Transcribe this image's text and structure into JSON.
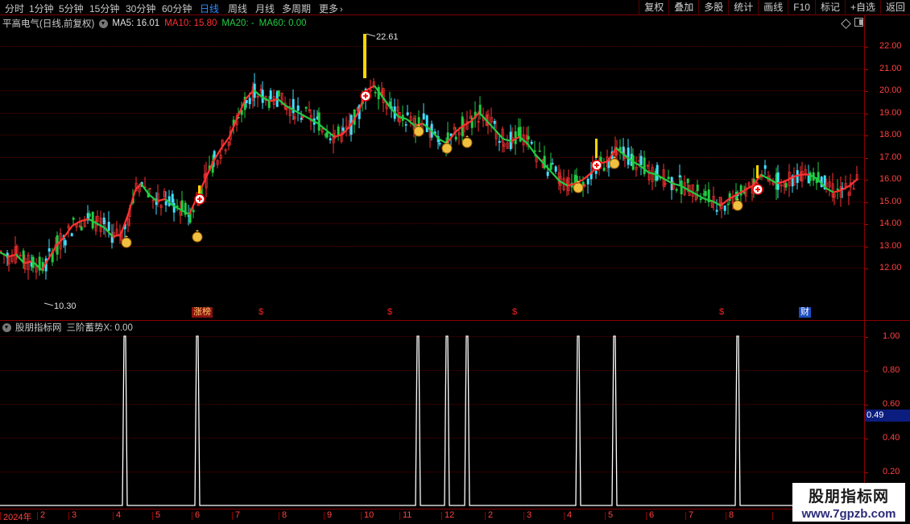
{
  "toolbar": {
    "periods": [
      {
        "label": "分时",
        "active": false
      },
      {
        "label": "1分钟",
        "active": false
      },
      {
        "label": "5分钟",
        "active": false
      },
      {
        "label": "15分钟",
        "active": false
      },
      {
        "label": "30分钟",
        "active": false
      },
      {
        "label": "60分钟",
        "active": false
      },
      {
        "label": "日线",
        "active": true
      },
      {
        "label": "周线",
        "active": false
      },
      {
        "label": "月线",
        "active": false
      },
      {
        "label": "多周期",
        "active": false
      },
      {
        "label": "更多",
        "active": false
      }
    ],
    "more_icon": "chevron-right-icon",
    "actions": [
      "复权",
      "叠加",
      "多股",
      "统计",
      "画线",
      "F10",
      "标记",
      "+自选",
      "返回"
    ]
  },
  "main_chart": {
    "title": "平高电气(日线,前复权)",
    "ma5": "MA5: 16.01",
    "ma10": "MA10: 15.80",
    "ma20": "MA20: -",
    "ma60": "MA60: 0.00",
    "high_label": "22.61",
    "low_label": "10.30"
  },
  "indicator": {
    "title": "股朋指标网",
    "formula": "三阶蓄势X: 0.00",
    "current_value": "0.49"
  },
  "event_markers": [
    {
      "label": "涨榜",
      "kind": "zt"
    },
    {
      "label": "$",
      "kind": "div"
    },
    {
      "label": "$",
      "kind": "div"
    },
    {
      "label": "$",
      "kind": "div"
    },
    {
      "label": "$",
      "kind": "div"
    },
    {
      "label": "财",
      "kind": "cai"
    }
  ],
  "watermark": {
    "name": "股朋指标网",
    "url": "www.7gpzb.com"
  },
  "colors": {
    "background": "#000000",
    "up": "#ff3232",
    "down": "#22cc44",
    "axis_text": "#ff4040",
    "grid": "#5a0000",
    "cyan_candle": "#40e0ff",
    "signal_line": "#ffffff"
  },
  "chart_data": [
    {
      "type": "candlestick",
      "title": "平高电气(日线,前复权)",
      "x_range": [
        "2024-01",
        "2024-08"
      ],
      "date_ticks": [
        "2024年",
        "2",
        "3",
        "4",
        "5",
        "6",
        "7",
        "8",
        "9",
        "10",
        "11",
        "12",
        "2",
        "3",
        "4",
        "5",
        "6",
        "7",
        "8"
      ],
      "price_ticks": [
        "22.00",
        "21.00",
        "20.00",
        "19.00",
        "18.00",
        "17.00",
        "16.00",
        "15.00",
        "14.00",
        "13.00",
        "12.00"
      ],
      "ylim": [
        10.3,
        22.61
      ],
      "price_points": [
        [
          0,
          12.7
        ],
        [
          10,
          12.5
        ],
        [
          20,
          12.6
        ],
        [
          30,
          12.2
        ],
        [
          40,
          12.3
        ],
        [
          52,
          11.9
        ],
        [
          60,
          12.4
        ],
        [
          70,
          13.0
        ],
        [
          80,
          13.4
        ],
        [
          90,
          13.9
        ],
        [
          100,
          14.1
        ],
        [
          110,
          14.2
        ],
        [
          120,
          14.0
        ],
        [
          130,
          13.8
        ],
        [
          140,
          13.4
        ],
        [
          150,
          13.5
        ],
        [
          160,
          14.5
        ],
        [
          168,
          15.5
        ],
        [
          175,
          15.8
        ],
        [
          185,
          15.3
        ],
        [
          195,
          15.0
        ],
        [
          205,
          15.1
        ],
        [
          215,
          14.8
        ],
        [
          225,
          14.6
        ],
        [
          235,
          14.4
        ],
        [
          245,
          15.2
        ],
        [
          255,
          16.0
        ],
        [
          265,
          16.8
        ],
        [
          275,
          17.4
        ],
        [
          285,
          17.9
        ],
        [
          295,
          18.8
        ],
        [
          305,
          19.6
        ],
        [
          315,
          20.0
        ],
        [
          325,
          19.7
        ],
        [
          335,
          19.5
        ],
        [
          345,
          19.6
        ],
        [
          355,
          19.3
        ],
        [
          365,
          19.1
        ],
        [
          375,
          18.9
        ],
        [
          385,
          18.7
        ],
        [
          395,
          18.5
        ],
        [
          405,
          18.2
        ],
        [
          415,
          17.9
        ],
        [
          425,
          18.0
        ],
        [
          435,
          18.4
        ],
        [
          445,
          19.0
        ],
        [
          455,
          20.0
        ],
        [
          465,
          20.2
        ],
        [
          475,
          19.7
        ],
        [
          485,
          19.2
        ],
        [
          495,
          18.8
        ],
        [
          505,
          18.7
        ],
        [
          515,
          18.4
        ],
        [
          525,
          18.5
        ],
        [
          535,
          18.2
        ],
        [
          545,
          17.8
        ],
        [
          555,
          17.6
        ],
        [
          565,
          18.1
        ],
        [
          575,
          18.4
        ],
        [
          585,
          18.6
        ],
        [
          595,
          19.0
        ],
        [
          605,
          18.6
        ],
        [
          615,
          18.2
        ],
        [
          625,
          17.8
        ],
        [
          635,
          17.7
        ],
        [
          645,
          17.9
        ],
        [
          655,
          17.6
        ],
        [
          665,
          17.1
        ],
        [
          675,
          16.7
        ],
        [
          685,
          16.3
        ],
        [
          695,
          15.9
        ],
        [
          705,
          15.7
        ],
        [
          715,
          15.8
        ],
        [
          725,
          16.0
        ],
        [
          735,
          16.3
        ],
        [
          745,
          16.7
        ],
        [
          755,
          16.8
        ],
        [
          765,
          17.4
        ],
        [
          775,
          17.1
        ],
        [
          785,
          16.8
        ],
        [
          795,
          16.6
        ],
        [
          805,
          16.3
        ],
        [
          815,
          16.2
        ],
        [
          825,
          16.0
        ],
        [
          835,
          15.8
        ],
        [
          845,
          15.7
        ],
        [
          855,
          15.5
        ],
        [
          865,
          15.3
        ],
        [
          875,
          15.1
        ],
        [
          885,
          15.0
        ],
        [
          895,
          14.8
        ],
        [
          905,
          15.1
        ],
        [
          915,
          15.3
        ],
        [
          925,
          15.5
        ],
        [
          935,
          15.7
        ],
        [
          945,
          16.2
        ],
        [
          955,
          16.0
        ],
        [
          965,
          15.8
        ],
        [
          975,
          15.9
        ],
        [
          985,
          16.1
        ],
        [
          995,
          16.2
        ],
        [
          1005,
          16.2
        ],
        [
          1015,
          16.0
        ],
        [
          1025,
          15.6
        ],
        [
          1035,
          15.4
        ],
        [
          1045,
          15.5
        ],
        [
          1055,
          15.7
        ],
        [
          1065,
          16.0
        ]
      ]
    },
    {
      "type": "line",
      "title": "三阶蓄势X",
      "y_ticks": [
        "1.00",
        "0.80",
        "0.60",
        "0.40",
        "0.20"
      ],
      "ylim": [
        0,
        1.0
      ],
      "series": [
        {
          "name": "三阶蓄势X",
          "spikes": [
            155,
            245,
            519,
            555,
            580,
            718,
            763,
            916
          ],
          "values": [
            1,
            1,
            1,
            1,
            1,
            1,
            1,
            1
          ]
        }
      ]
    }
  ]
}
